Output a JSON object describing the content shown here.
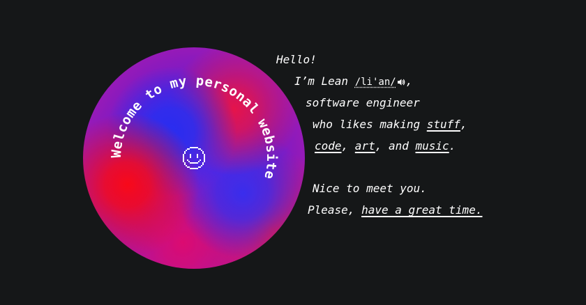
{
  "orb": {
    "curved_title": "Welcome to my personal website",
    "smiley_icon": "pixel-smiley-icon",
    "colors": {
      "background": "#151718",
      "red": "#e0101e",
      "blue": "#2c2fd8",
      "purple": "#7a22c0"
    }
  },
  "intro": {
    "greeting": "Hello!",
    "name_prefix": "I’m Lean ",
    "pronunciation": "/li'an/",
    "pronunciation_icon": "speaker-icon",
    "name_suffix": ",",
    "role": "software engineer",
    "likes_prefix": "who likes making ",
    "stuff_link": "stuff",
    "likes_suffix": ",",
    "code_link": "code",
    "sep1": ", ",
    "art_link": "art",
    "sep2": ", and ",
    "music_link": "music",
    "period": ".",
    "nice": "Nice to meet you.",
    "please_prefix": "Please, ",
    "great_time_link": "have a great time."
  }
}
